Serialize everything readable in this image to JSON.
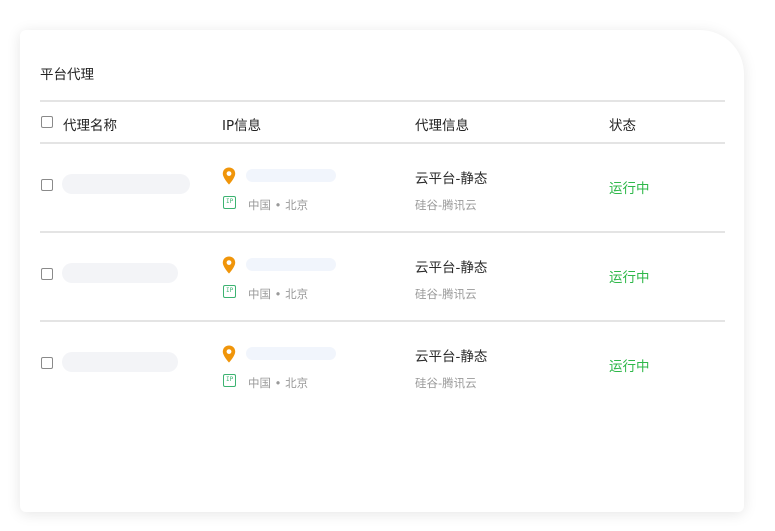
{
  "card": {
    "title": "平台代理"
  },
  "table": {
    "columns": {
      "name": "代理名称",
      "ip": "IP信息",
      "proxy": "代理信息",
      "status": "状态"
    },
    "rows": [
      {
        "location": "中国 • 北京",
        "proxy_type": "云平台-静态",
        "provider": "硅谷-腾讯云",
        "status": "运行中"
      },
      {
        "location": "中国 • 北京",
        "proxy_type": "云平台-静态",
        "provider": "硅谷-腾讯云",
        "status": "运行中"
      },
      {
        "location": "中国 • 北京",
        "proxy_type": "云平台-静态",
        "provider": "硅谷-腾讯云",
        "status": "运行中"
      }
    ]
  },
  "colors": {
    "status_running": "#2fb84a",
    "location_pin": "#f0950a",
    "ipv_icon": "#3cb371",
    "skeleton": "#f3f4f7"
  },
  "icons": {
    "location": "location-pin-icon",
    "ip_type": "ipv-icon"
  }
}
